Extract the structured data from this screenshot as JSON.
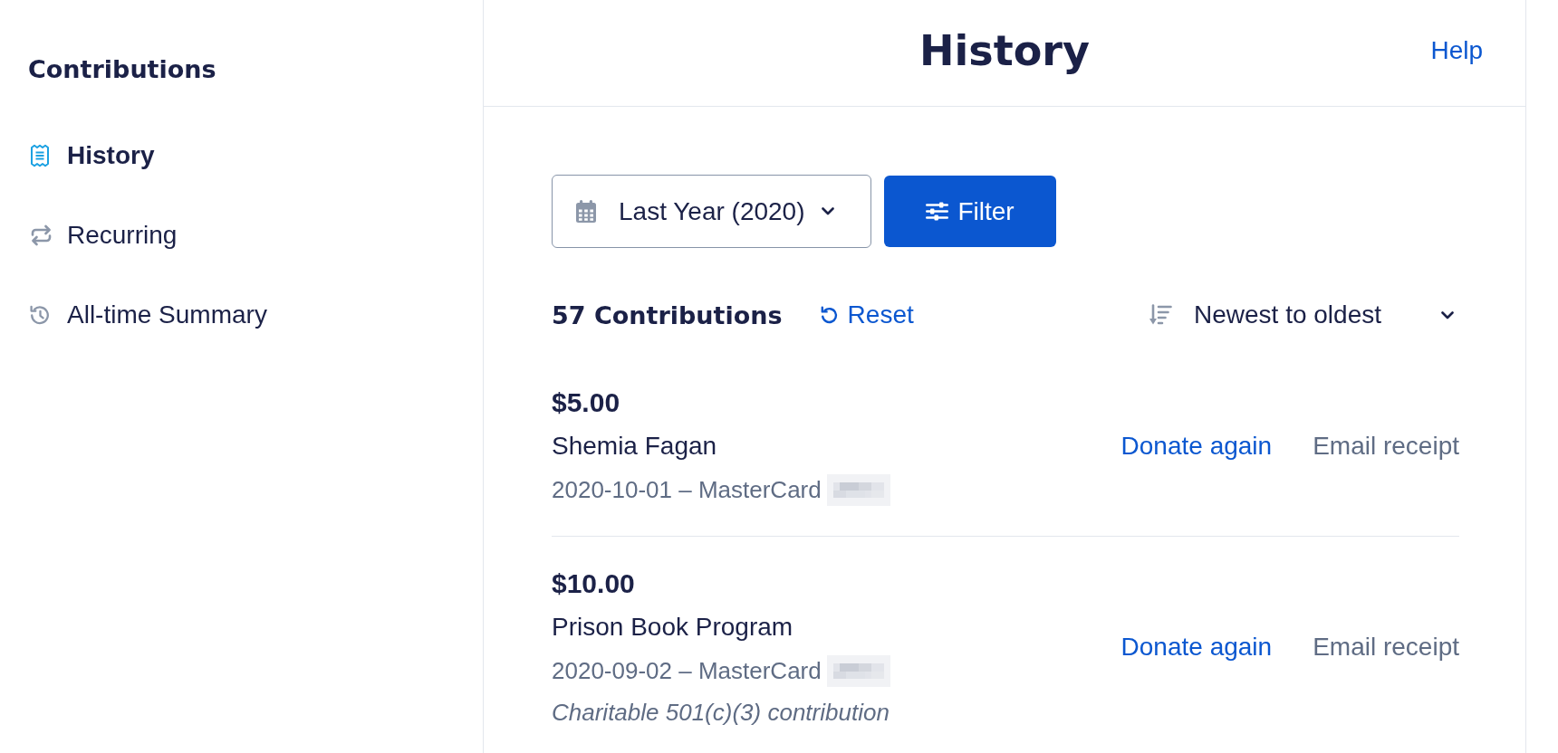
{
  "sidebar": {
    "title": "Contributions",
    "items": [
      {
        "label": "History",
        "selected": true
      },
      {
        "label": "Recurring",
        "selected": false
      },
      {
        "label": "All-time Summary",
        "selected": false
      }
    ]
  },
  "header": {
    "title": "History",
    "help_link": "Help"
  },
  "toolbar": {
    "date_range": {
      "value": "Last Year (2020)"
    },
    "filter_button": "Filter"
  },
  "results": {
    "count": "57 Contributions",
    "reset_link": "Reset",
    "sort": {
      "value": "Newest to oldest"
    }
  },
  "contributions": [
    {
      "amount": "$5.00",
      "recipient": "Shemia Fagan",
      "details": "2020-10-01 – MasterCard",
      "card_number_redacted": true,
      "donate_again_link": "Donate again",
      "email_receipt_link": "Email receipt"
    },
    {
      "amount": "$10.00",
      "recipient": "Prison Book Program",
      "details": "2020-09-02 – MasterCard",
      "card_number_redacted": true,
      "note": "Charitable 501(c)(3) contribution",
      "donate_again_link": "Donate again",
      "email_receipt_link": "Email receipt"
    }
  ]
}
